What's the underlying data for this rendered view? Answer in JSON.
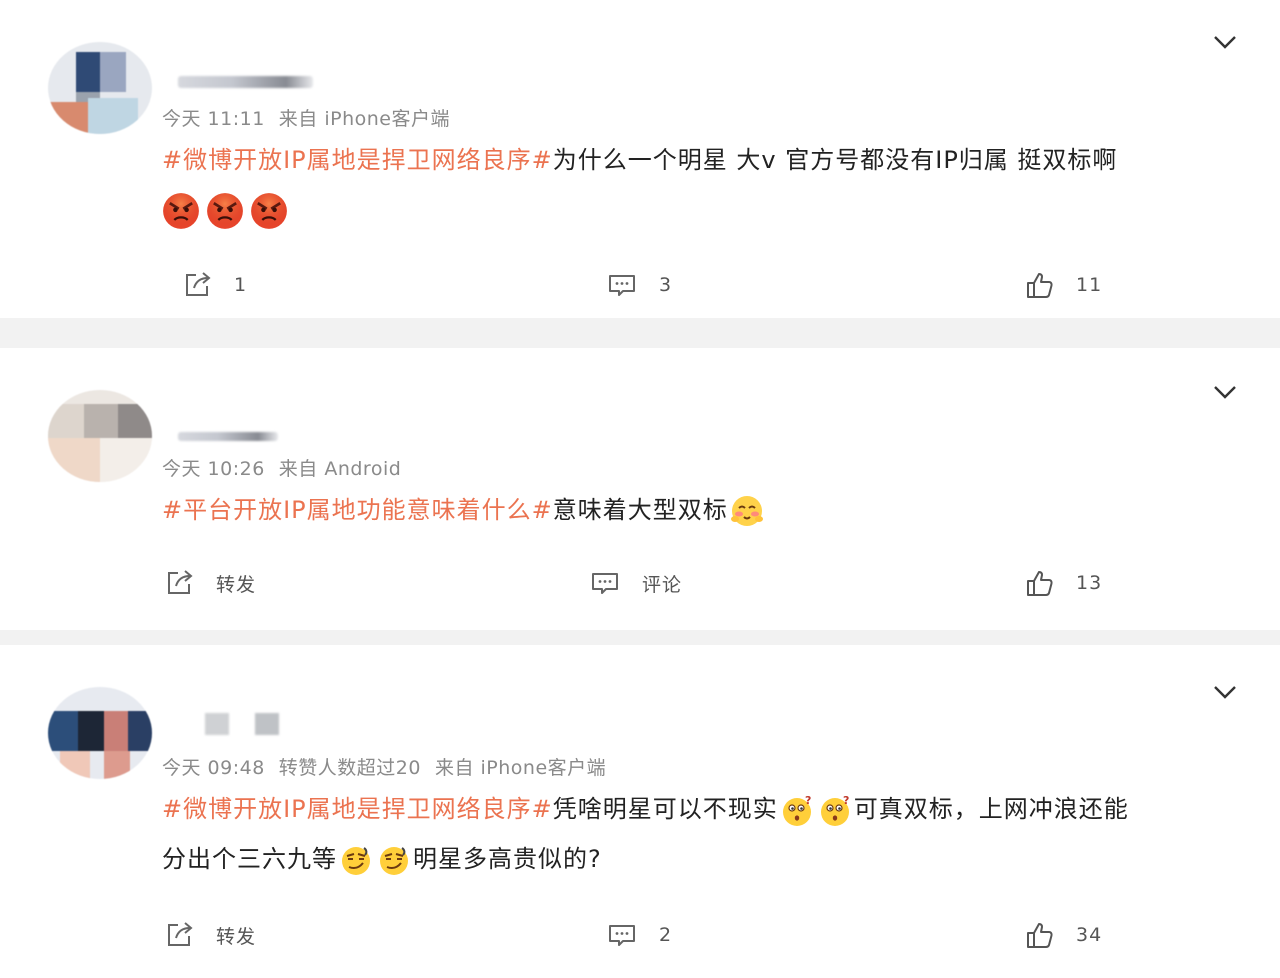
{
  "posts": [
    {
      "time": "今天 11:11",
      "source": "来自 iPhone客户端",
      "extra": "",
      "tag": "#微博开放IP属地是捍卫网络良序#",
      "text_line1": "为什么一个明星 大v 官方号都没有IP归属 挺双标啊",
      "text_line2": "",
      "forward": "1",
      "comment": "3",
      "like": "11"
    },
    {
      "time": "今天 10:26",
      "source": "来自 Android",
      "extra": "",
      "tag": "#平台开放IP属地功能意味着什么#",
      "text_line1": "意味着大型双标",
      "text_line2": "",
      "forward": "转发",
      "comment": "评论",
      "like": "13"
    },
    {
      "time": "今天 09:48",
      "source": "来自 iPhone客户端",
      "extra": "转赞人数超过20",
      "tag": "#微博开放IP属地是捍卫网络良序#",
      "text_line1a": "凭啥明星可以不现实",
      "text_line1b": "可真双标，上网冲浪还能",
      "text_line2a": "分出个三六九等",
      "text_line2b": "明星多高贵似的?",
      "forward": "转发",
      "comment": "2",
      "like": "34"
    }
  ],
  "icons": {
    "forward": "share-square-icon",
    "comment": "comment-bubble-icon",
    "like": "thumbs-up-icon",
    "menu": "chevron-down-icon",
    "angry": "angry-face-emoji-icon",
    "blush": "blushing-face-emoji-icon",
    "question": "thinking-face-emoji-icon",
    "smirk": "smirk-face-emoji-icon"
  },
  "colors": {
    "hashtag": "#eb7350",
    "text": "#222222",
    "meta": "#8a8a8a",
    "background": "#f2f2f2"
  }
}
